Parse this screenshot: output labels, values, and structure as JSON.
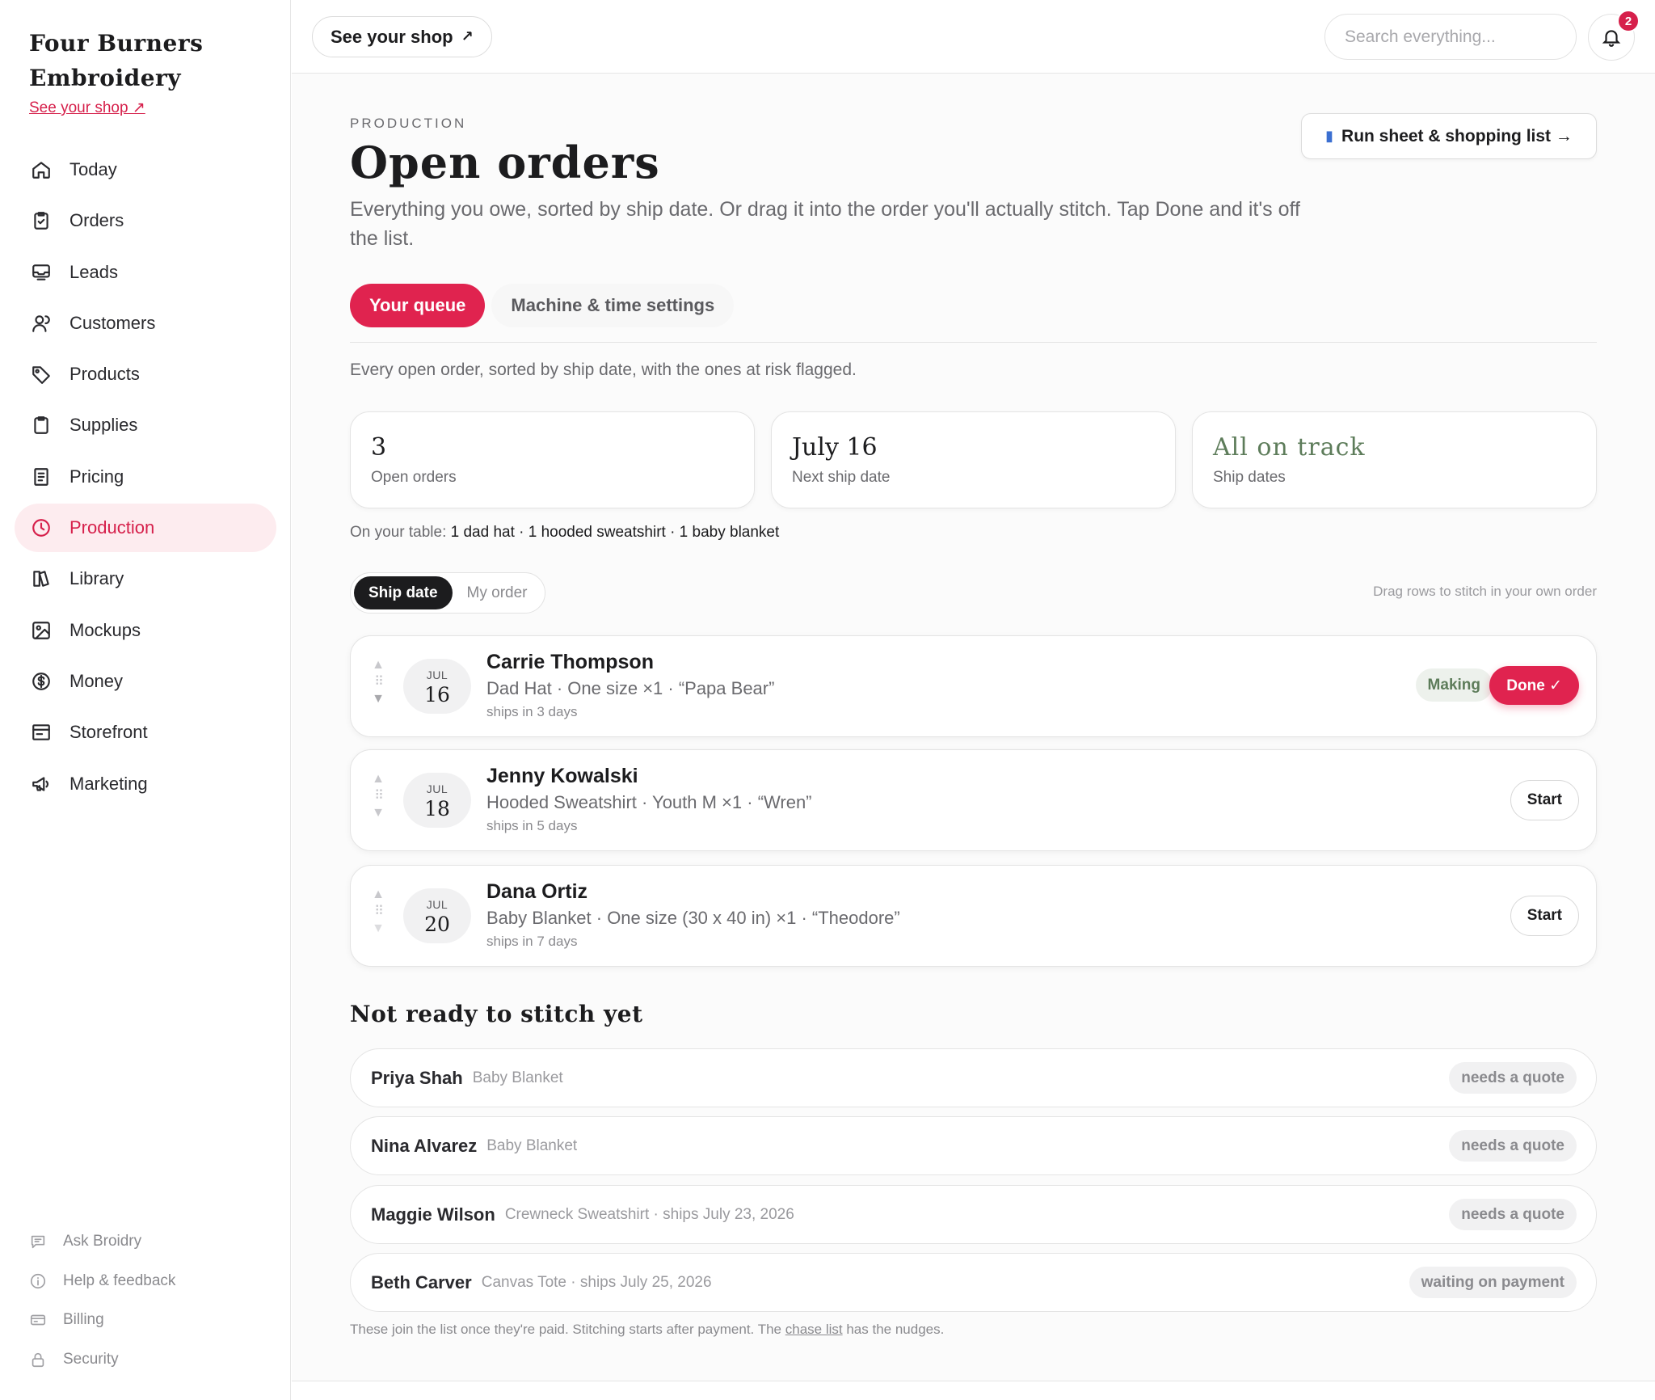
{
  "brand": {
    "line1": "Four Burners",
    "line2": "Embroidery",
    "shop_link": "See your shop ↗"
  },
  "nav": [
    {
      "label": "Today",
      "icon": "home-icon"
    },
    {
      "label": "Orders",
      "icon": "clipboard-check-icon"
    },
    {
      "label": "Leads",
      "icon": "inbox-icon"
    },
    {
      "label": "Customers",
      "icon": "users-icon"
    },
    {
      "label": "Products",
      "icon": "tag-icon"
    },
    {
      "label": "Supplies",
      "icon": "clipboard-icon"
    },
    {
      "label": "Pricing",
      "icon": "receipt-icon"
    },
    {
      "label": "Production",
      "icon": "clock-icon",
      "active": true
    },
    {
      "label": "Library",
      "icon": "book-icon"
    },
    {
      "label": "Mockups",
      "icon": "image-icon"
    },
    {
      "label": "Money",
      "icon": "dollar-icon"
    },
    {
      "label": "Storefront",
      "icon": "storefront-icon"
    },
    {
      "label": "Marketing",
      "icon": "megaphone-icon"
    }
  ],
  "footer_nav": [
    {
      "label": "Ask Broidry",
      "icon": "chat-icon"
    },
    {
      "label": "Help & feedback",
      "icon": "info-icon"
    },
    {
      "label": "Billing",
      "icon": "credit-card-icon"
    },
    {
      "label": "Security",
      "icon": "lock-icon"
    }
  ],
  "topbar": {
    "shop_button": "See your shop",
    "shop_arrow": "↗",
    "search_placeholder": "Search everything...",
    "notification_count": "2"
  },
  "header": {
    "eyebrow": "PRODUCTION",
    "title": "Open orders",
    "subtitle": "Everything you owe, sorted by ship date. Or drag it into the order you'll actually stitch. Tap Done and it's off the list.",
    "run_sheet_button": "Run sheet & shopping list →"
  },
  "tabs": {
    "active": "Your queue",
    "other": "Machine & time settings"
  },
  "intro": "Every open order, sorted by ship date, with the ones at risk flagged.",
  "stats": [
    {
      "value": "3",
      "label": "Open orders"
    },
    {
      "value": "July 16",
      "label": "Next ship date"
    },
    {
      "value": "All on track",
      "label": "Ship dates"
    }
  ],
  "on_table": {
    "prefix": "On your table:",
    "items": "1 dad hat · 1 hooded sweatshirt · 1 baby blanket"
  },
  "sort": {
    "active": "Ship date",
    "other": "My order",
    "hint": "Drag rows to stitch in your own order"
  },
  "orders": [
    {
      "month": "JUL",
      "day": "16",
      "name": "Carrie Thompson",
      "desc": "Dad Hat · One size ×1 · “Papa Bear”",
      "ships": "ships in 3 days",
      "status": "Making",
      "action": "Done ✓"
    },
    {
      "month": "JUL",
      "day": "18",
      "name": "Jenny Kowalski",
      "desc": "Hooded Sweatshirt · Youth M ×1 · “Wren”",
      "ships": "ships in 5 days",
      "action": "Start"
    },
    {
      "month": "JUL",
      "day": "20",
      "name": "Dana Ortiz",
      "desc": "Baby Blanket · One size (30 x 40 in) ×1 · “Theodore”",
      "ships": "ships in 7 days",
      "action": "Start"
    }
  ],
  "not_ready": {
    "title": "Not ready to stitch yet",
    "items": [
      {
        "name": "Priya Shah",
        "desc": "Baby Blanket",
        "tag": "needs a quote"
      },
      {
        "name": "Nina Alvarez",
        "desc": "Baby Blanket",
        "tag": "needs a quote"
      },
      {
        "name": "Maggie Wilson",
        "desc": "Crewneck Sweatshirt · ships July 23, 2026",
        "tag": "needs a quote"
      },
      {
        "name": "Beth Carver",
        "desc": "Canvas Tote · ships July 25, 2026",
        "tag": "waiting on payment"
      }
    ],
    "footnote_pre": "These join the list once they're paid. Stitching starts after payment. The",
    "footnote_link": "chase list",
    "footnote_post": "has the nudges."
  },
  "colors": {
    "accent": "#e0234f",
    "ok": "#5d7c5a"
  }
}
